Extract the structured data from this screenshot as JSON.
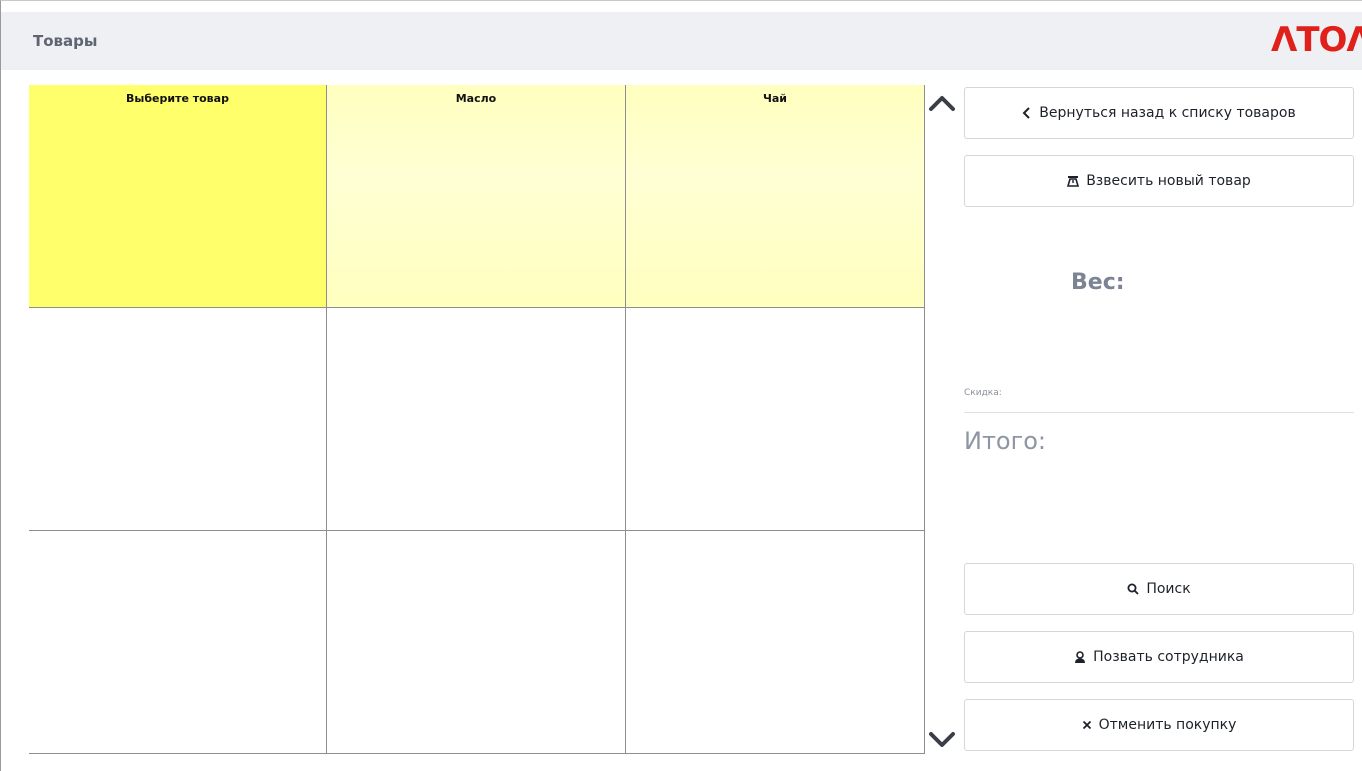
{
  "header": {
    "title": "Товары",
    "logo_text": "ΛΤΟΛ",
    "logo_color": "#e0201b"
  },
  "products": [
    [
      "Выберите товар",
      "Масло",
      "Чай"
    ],
    [
      "",
      "",
      ""
    ],
    [
      "",
      "",
      ""
    ]
  ],
  "colors": {
    "selected": "#ffff6b",
    "available": "#ffffcc",
    "header_bg": "#eff0f4"
  },
  "scroll": {
    "up_icon": "chevron-up-icon",
    "down_icon": "chevron-down-icon"
  },
  "side": {
    "back_label": "Вернуться назад к списку товаров",
    "weigh_label": "Взвесить новый товар",
    "weight_label": "Вес:",
    "discount_label": "Скидка:",
    "total_label": "Итого:",
    "search_label": "Поиск",
    "call_staff_label": "Позвать сотрудника",
    "cancel_label": "Отменить покупку"
  }
}
